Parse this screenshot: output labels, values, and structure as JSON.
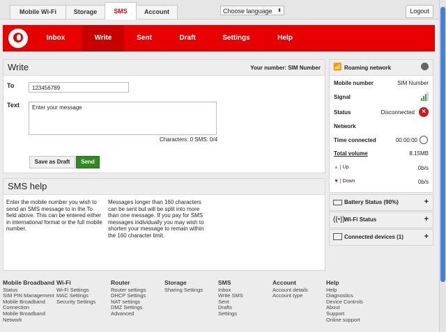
{
  "tabs": [
    {
      "label": "Mobile Wi-Fi",
      "active": false
    },
    {
      "label": "Storage",
      "active": false
    },
    {
      "label": "SMS",
      "active": true
    },
    {
      "label": "Account",
      "active": false
    }
  ],
  "language": {
    "value": "Choose language",
    "arrow": "⬍"
  },
  "logout_label": "Logout",
  "nav": [
    {
      "label": "Inbox",
      "active": false
    },
    {
      "label": "Write",
      "active": true
    },
    {
      "label": "Sent",
      "active": false
    },
    {
      "label": "Draft",
      "active": false
    },
    {
      "label": "Settings",
      "active": false
    },
    {
      "label": "Help",
      "active": false
    }
  ],
  "write": {
    "title": "Write",
    "your_number": "Your number: SIM Number",
    "to_label": "To",
    "to_value": "123456789",
    "text_label": "Text",
    "text_value": "Enter your message",
    "counter": "Characters: 0 SMS: 0/4",
    "save_draft": "Save as Draft",
    "send": "Send"
  },
  "help": {
    "title": "SMS help",
    "col1": "Enter the mobile number you wish to send an SMS message to in the To field above. This can be entered either in international format or the full mobile number.",
    "col2": "Messages longer than 160 characters can be sent but will be split into more than one message. If you pay for SMS messages individually you may wish to shorten your message to remain within the 160 character limit."
  },
  "sidebar": {
    "roaming_title": "Roaming network",
    "mobile_number_label": "Mobile number",
    "mobile_number_value": "SIM Number",
    "signal_label": "Signal",
    "signal_bars": 3,
    "status_label": "Status",
    "status_value": "Disconnected",
    "network_label": "Network",
    "time_label": "Time connected",
    "time_value": "00:00:00",
    "volume_label": "Total volume",
    "volume_value": "8.15MB",
    "up_label": "Up",
    "up_value": "0b/s",
    "down_label": "Down",
    "down_value": "0b/s",
    "battery": "Battery Status (90%)",
    "wifi": "Wi-Fi Status",
    "devices": "Connected devices (1)",
    "plus": "+"
  },
  "footer": [
    {
      "heading": "Mobile Broadband",
      "links": [
        "Status",
        "SIM PIN Management",
        "Mobile Broadband",
        "Connection",
        "Mobile Broadband",
        "Network"
      ]
    },
    {
      "heading": "Wi-Fi",
      "links": [
        "Wi-Fi Settings",
        "MAC Settings",
        "Security Settings"
      ]
    },
    {
      "heading": "Router",
      "links": [
        "Router settings",
        "DHCP Settings",
        "NAT settings",
        "DMZ Settings",
        "Advanced"
      ]
    },
    {
      "heading": "Storage",
      "links": [
        "Sharing Settings"
      ]
    },
    {
      "heading": "SMS",
      "links": [
        "Inbox",
        "Write SMS",
        "Sent",
        "Drafts",
        "Settings"
      ]
    },
    {
      "heading": "Account",
      "links": [
        "Account details",
        "Account type"
      ]
    },
    {
      "heading": "Help",
      "links": [
        "Help",
        "Diagnostics",
        "Device Controls",
        "About",
        "Support",
        "Online support"
      ]
    }
  ],
  "colors": {
    "brand": "#e60000",
    "send": "#2e8b1f",
    "error": "#cc1a1a",
    "signal": "#3aa53a"
  }
}
